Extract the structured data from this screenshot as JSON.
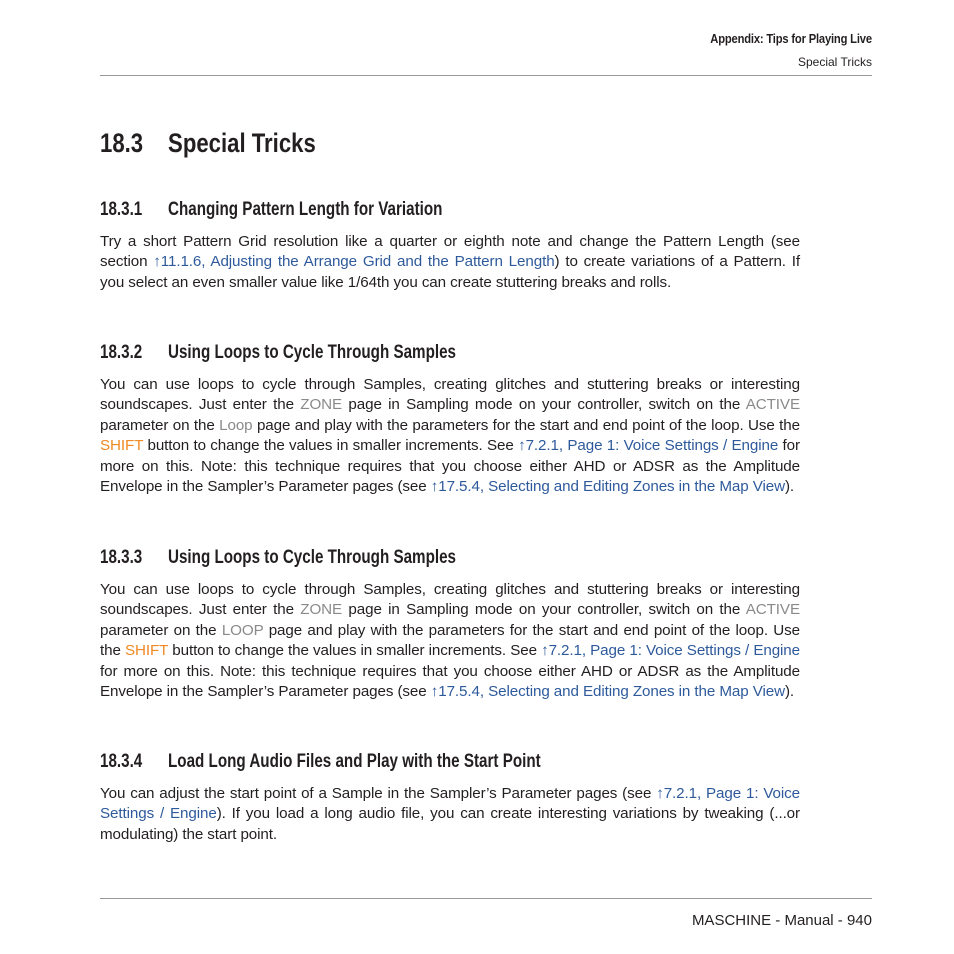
{
  "header": {
    "chapter": "Appendix: Tips for Playing Live",
    "section": "Special Tricks"
  },
  "main": {
    "section": {
      "number": "18.3",
      "title": "Special Tricks"
    },
    "subsections": [
      {
        "number": "18.3.1",
        "title": "Changing Pattern Length for Variation",
        "text1": "Try a short Pattern Grid resolution like a quarter or eighth note and change the Pattern Length (see section ",
        "link1": "↑11.1.6, Adjusting the Arrange Grid and the Pattern Length",
        "text2": ") to create variations of a Pattern. If you select an even smaller value like 1/64th you can create stuttering breaks and rolls."
      },
      {
        "number": "18.3.2",
        "title": "Using Loops to Cycle Through Samples",
        "t1": "You can use loops to cycle through Samples, creating glitches and stuttering breaks or interest­ing soundscapes. Just enter the ",
        "zone": "ZONE",
        "t2": " page in Sampling mode on your controller, switch on the ",
        "active": "ACTIVE",
        "t3": " parameter on the ",
        "loop": "Loop",
        "t4": " page and play with the parameters for the start and end point of the loop. Use the ",
        "shift": "SHIFT",
        "t5": " button to change the values in smaller increments. See ",
        "link1": "↑7.2.1, Page 1: Voice Settings / Engine",
        "t6": " for more on this. Note: this technique requires that you choose either AHD or ADSR as the Amplitude Envelope in the Sampler’s Parameter pages (see ",
        "link2": "↑17.5.4, Selecting and Editing Zones in the Map View",
        "t7": ")."
      },
      {
        "number": "18.3.3",
        "title": "Using Loops to Cycle Through Samples",
        "t1": "You can use loops to cycle through Samples, creating glitches and stuttering breaks or interest­ing soundscapes. Just enter the ",
        "zone": "ZONE",
        "t2": " page in Sampling mode on your controller, switch on the ",
        "active": "ACTIVE",
        "t3": " parameter on the ",
        "loop": "LOOP",
        "t4": " page and play with the parameters for the start and end point of the loop. Use the ",
        "shift": "SHIFT",
        "t5": " button to change the values in smaller increments. See ",
        "link1": "↑7.2.1, Page 1: Voice Settings / Engine",
        "t6": " for more on this. Note: this technique requires that you choose either AHD or ADSR as the Amplitude Envelope in the Sampler’s Parameter pages (see ",
        "link2": "↑17.5.4, Selecting and Editing Zones in the Map View",
        "t7": ")."
      },
      {
        "number": "18.3.4",
        "title": "Load Long Audio Files and Play with the Start Point",
        "t1": "You can adjust the start point of a Sample in the Sampler’s Parameter pages (see ",
        "link1": "↑7.2.1, Page 1: Voice Settings / Engine",
        "t2": "). If you load a long audio file, you can create interesting variations by tweaking (...or modulating) the start point."
      }
    ]
  },
  "footer": {
    "text": "MASCHINE - Manual - 940"
  },
  "colors": {
    "link": "#2e5a9c",
    "param_gray": "#8a8a8a",
    "shift_orange": "#f08a24",
    "rule": "#999999"
  }
}
